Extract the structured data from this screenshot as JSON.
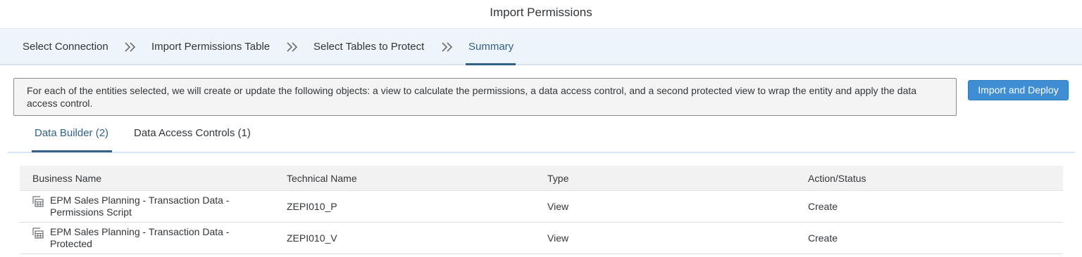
{
  "header": {
    "title": "Import Permissions"
  },
  "wizard": {
    "steps": [
      {
        "label": "Select Connection"
      },
      {
        "label": "Import Permissions Table"
      },
      {
        "label": "Select Tables to Protect"
      },
      {
        "label": "Summary",
        "active": true
      }
    ]
  },
  "info": {
    "message": "For each of the entities selected, we will create or update the following objects: a view to calculate the permissions, a data access control, and a second protected view to wrap the entity and apply the data access control."
  },
  "actions": {
    "import_deploy_label": "Import and Deploy"
  },
  "tabs": [
    {
      "label": "Data Builder (2)",
      "active": true
    },
    {
      "label": "Data Access Controls (1)"
    }
  ],
  "table": {
    "columns": [
      "Business Name",
      "Technical Name",
      "Type",
      "Action/Status"
    ],
    "rows": [
      {
        "icon": "view-table-icon",
        "business_name": "EPM Sales Planning - Transaction Data - Permissions Script",
        "technical_name": "ZEPI010_P",
        "type": "View",
        "action_status": "Create"
      },
      {
        "icon": "view-table-icon",
        "business_name": "EPM Sales Planning - Transaction Data - Protected",
        "technical_name": "ZEPI010_V",
        "type": "View",
        "action_status": "Create"
      }
    ]
  },
  "colors": {
    "accent": "#346187",
    "button": "#3f8ed3",
    "wizard_bg": "#edf4fa"
  }
}
